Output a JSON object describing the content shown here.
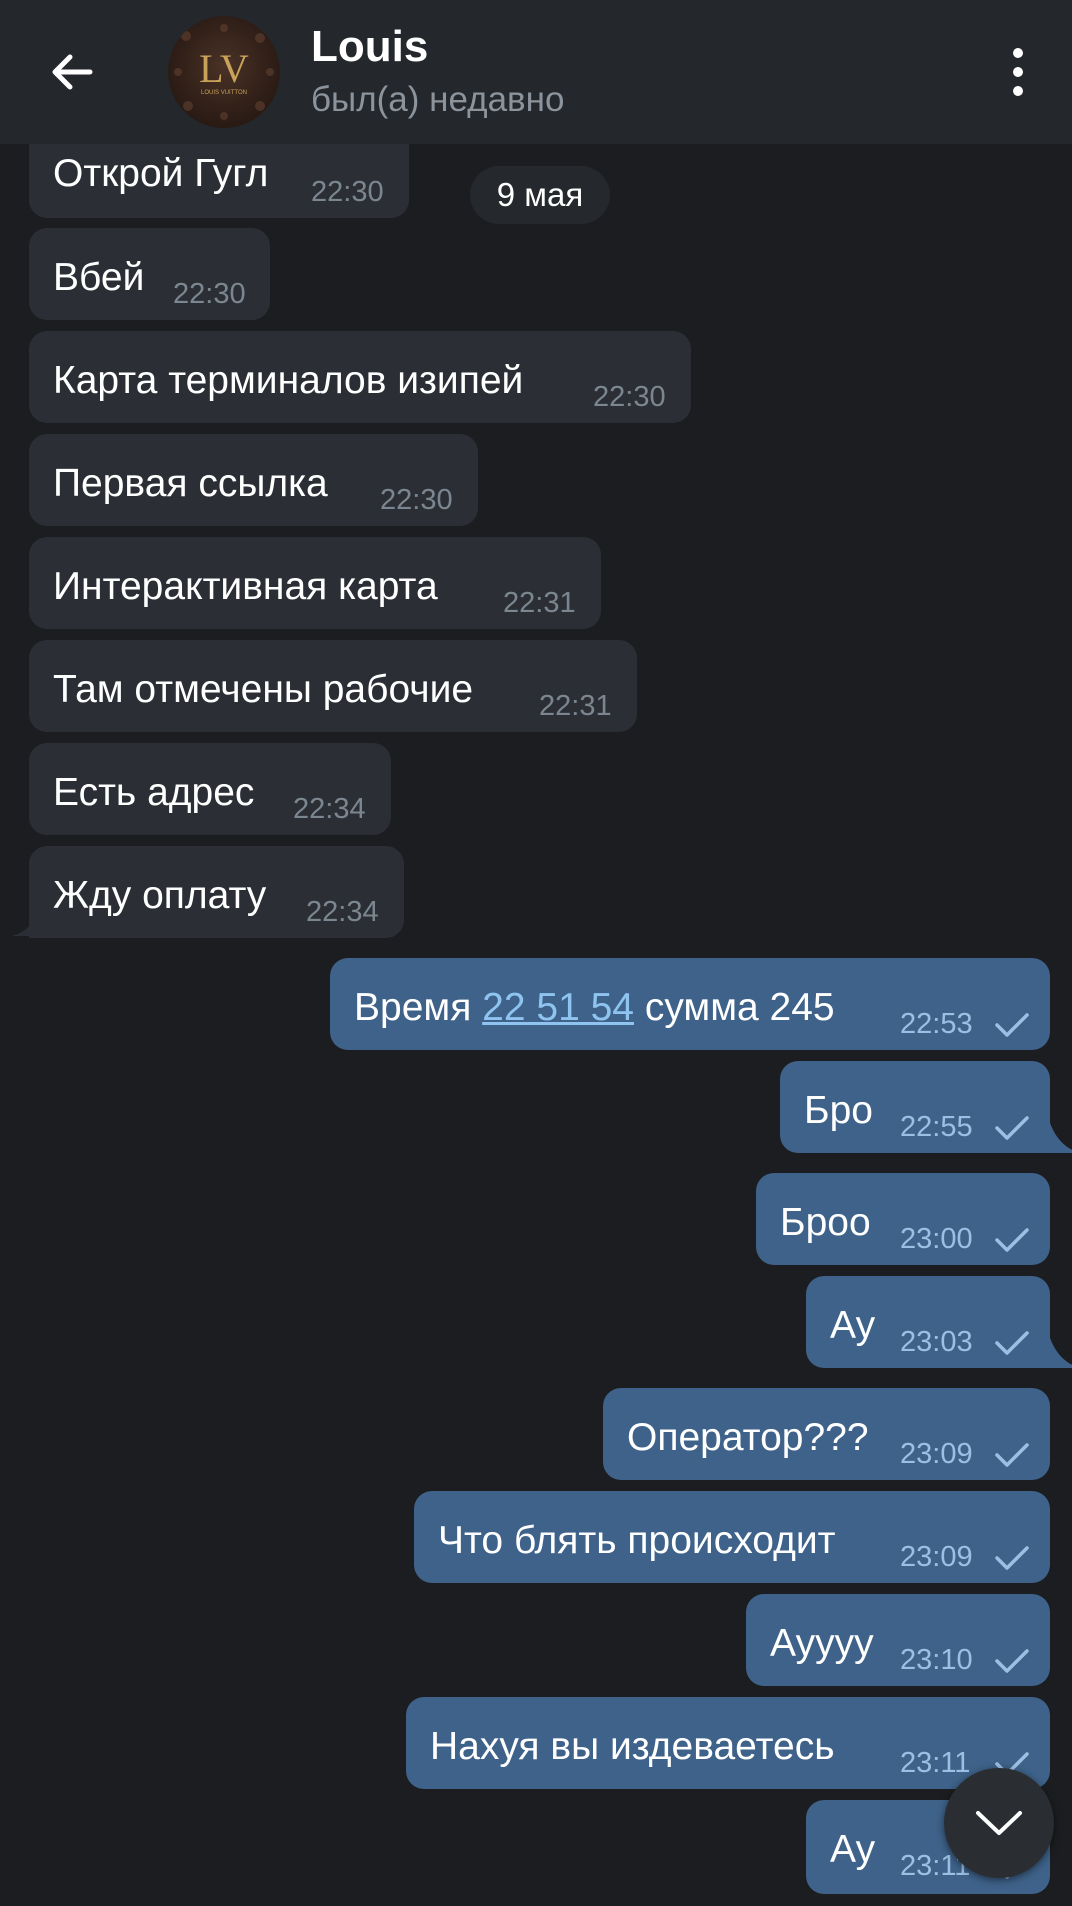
{
  "header": {
    "contact_name": "Louis",
    "status": "был(а) недавно",
    "avatar_monogram": "LV",
    "avatar_small_text": "LOUIS VUITTON"
  },
  "date_separator": "9 мая",
  "incoming": [
    {
      "text": "Открой Гугл",
      "time": "22:30"
    },
    {
      "text": "Вбей",
      "time": "22:30"
    },
    {
      "text": "Карта терминалов изипей",
      "time": "22:30"
    },
    {
      "text": "Первая ссылка",
      "time": "22:30"
    },
    {
      "text": "Интерактивная карта",
      "time": "22:31"
    },
    {
      "text": "Там отмечены рабочие",
      "time": "22:31"
    },
    {
      "text": "Есть адрес",
      "time": "22:34"
    },
    {
      "text": "Жду оплату",
      "time": "22:34"
    }
  ],
  "outgoing": [
    {
      "text_before": "Время",
      "link": "22 51 54",
      "text_after": "сумма 245",
      "time": "22:53"
    },
    {
      "text": "Бро",
      "time": "22:55"
    },
    {
      "text": "Броо",
      "time": "23:00"
    },
    {
      "text": "Ау",
      "time": "23:03"
    },
    {
      "text": "Оператор???",
      "time": "23:09"
    },
    {
      "text": "Что блять происходит",
      "time": "23:09"
    },
    {
      "text": "Ауууу",
      "time": "23:10"
    },
    {
      "text": "Нахуя вы издеваетесь",
      "time": "23:11"
    },
    {
      "text": "Ау",
      "time": "23:11"
    }
  ],
  "colors": {
    "background": "#1c1d20",
    "header": "#24272b",
    "incoming_bubble": "#2b2f35",
    "outgoing_bubble": "#3e6289",
    "link": "#8fc4f1"
  }
}
